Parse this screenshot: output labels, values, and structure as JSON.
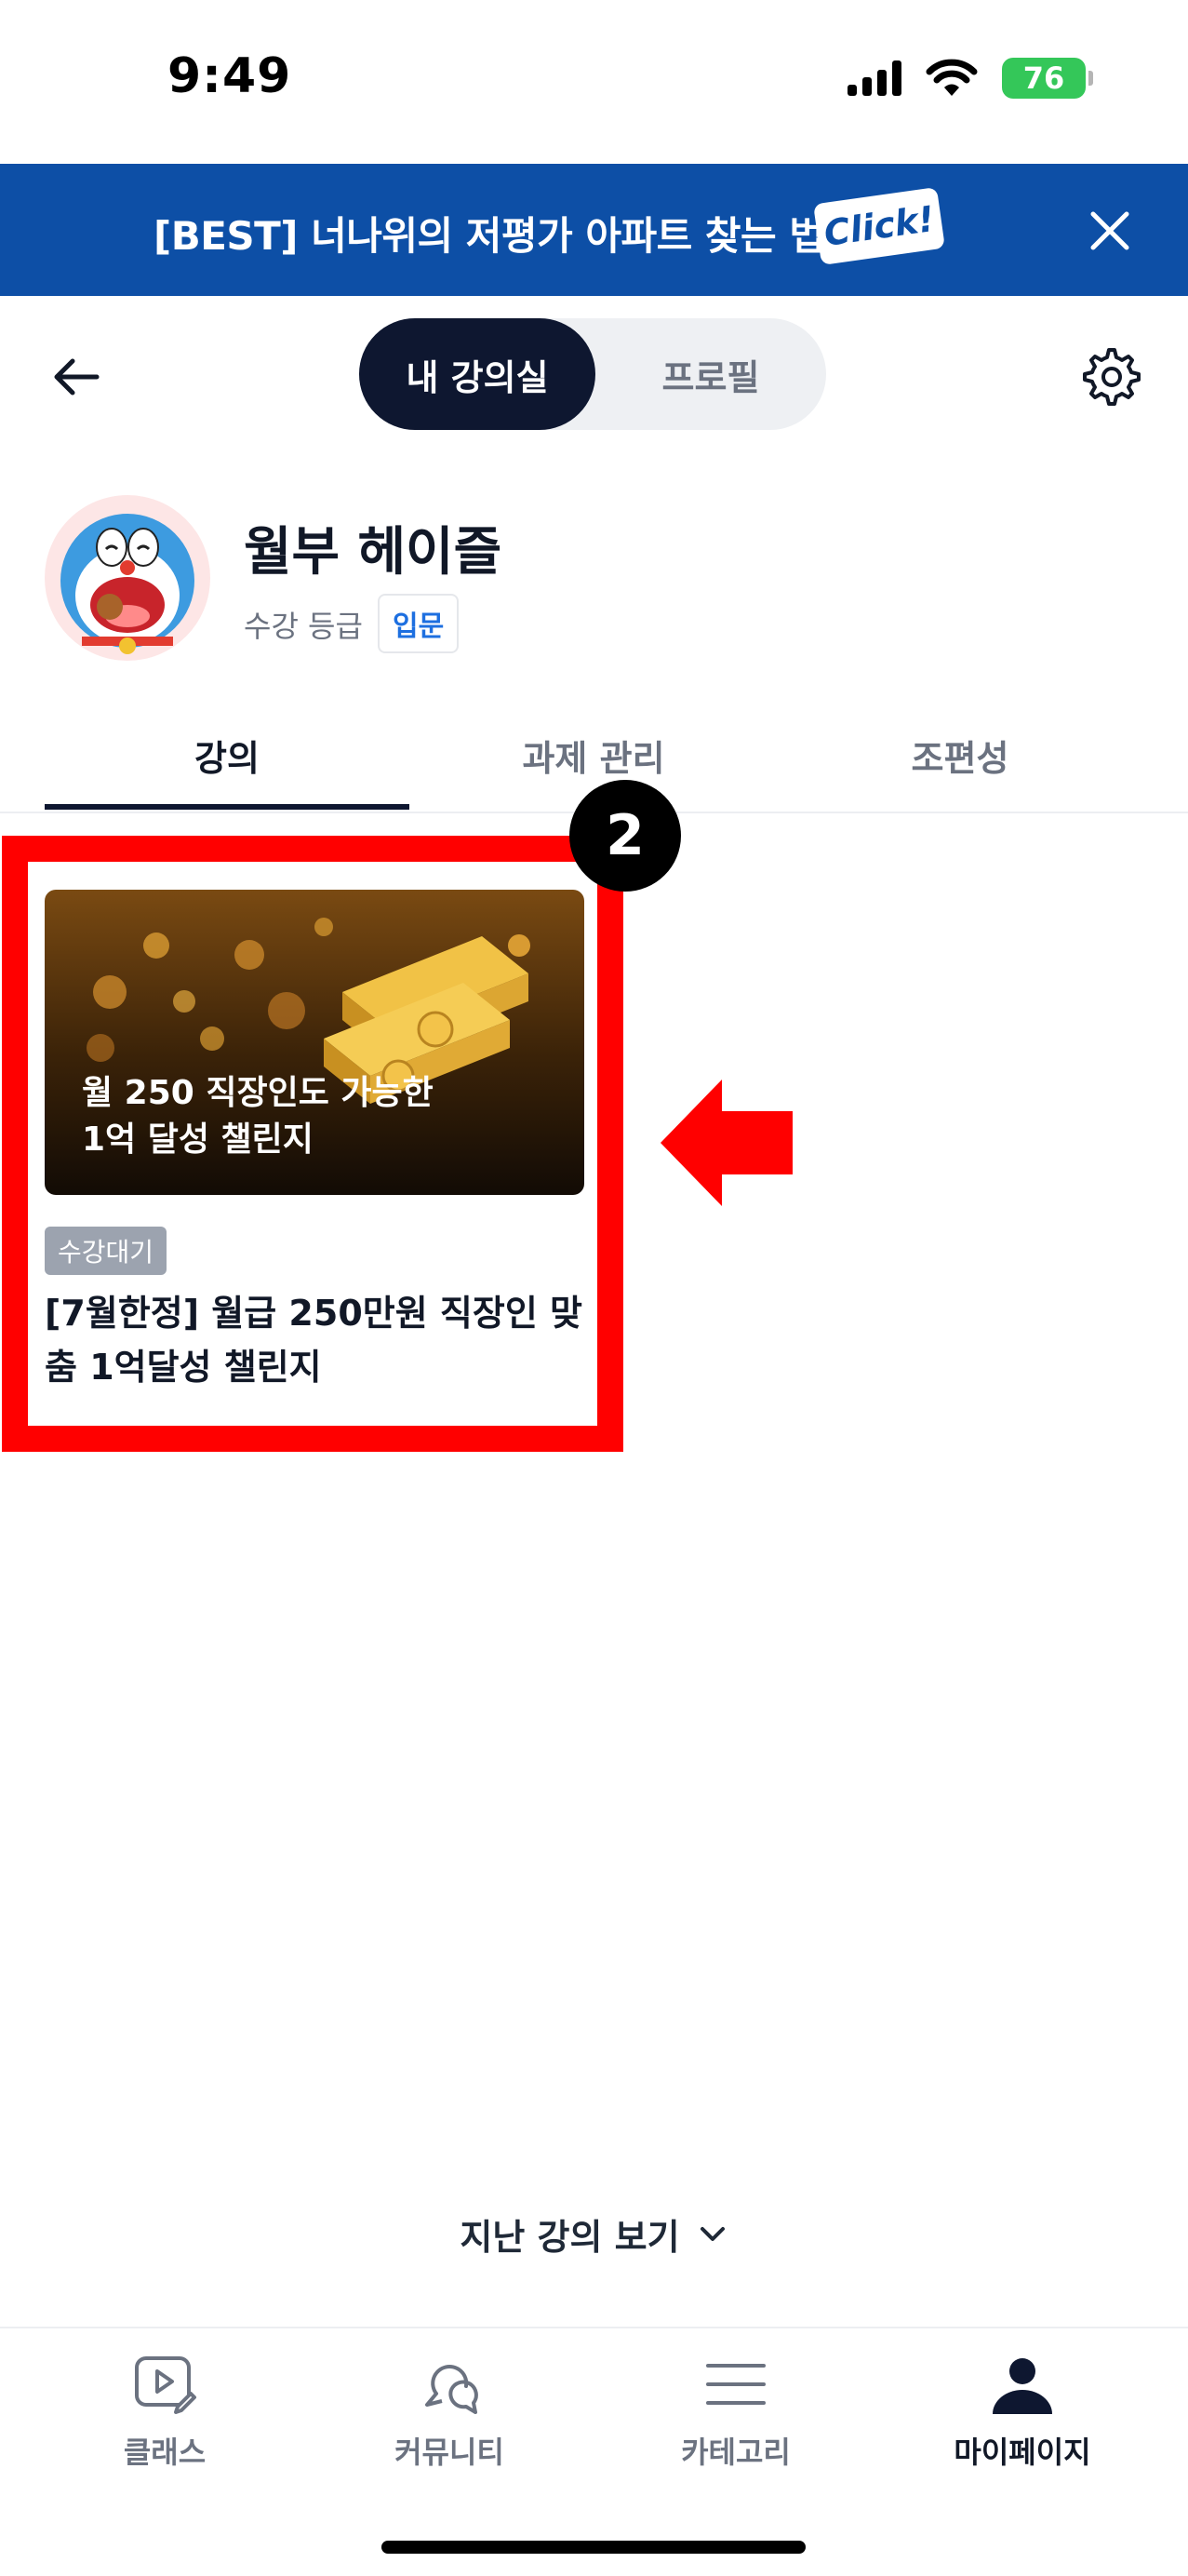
{
  "status_bar": {
    "time": "9:49",
    "battery": "76"
  },
  "promo_banner": {
    "text": "[BEST] 너나위의 저평가 아파트 찾는 법",
    "click_label": "Click!"
  },
  "header": {
    "toggle": {
      "active_label": "내 강의실",
      "inactive_label": "프로필"
    }
  },
  "profile": {
    "name": "월부 헤이즐",
    "grade_label": "수강 등급",
    "grade_value": "입문"
  },
  "tabs": [
    {
      "label": "강의",
      "active": true
    },
    {
      "label": "과제 관리",
      "active": false
    },
    {
      "label": "조편성",
      "active": false
    }
  ],
  "annotation": {
    "step_number": "2",
    "highlight_color": "#ff0000"
  },
  "course": {
    "thumbnail_text_line1": "월 250 직장인도 가능한",
    "thumbnail_text_line2": "1억 달성 챌린지",
    "status_chip": "수강대기",
    "title": "[7월한정] 월급 250만원 직장인 맞춤 1억달성 챌린지"
  },
  "past_lectures": {
    "label": "지난 강의 보기"
  },
  "bottom_nav": [
    {
      "label": "클래스",
      "icon": "class-play-icon",
      "active": false
    },
    {
      "label": "커뮤니티",
      "icon": "community-chat-icon",
      "active": false
    },
    {
      "label": "카테고리",
      "icon": "category-menu-icon",
      "active": false
    },
    {
      "label": "마이페이지",
      "icon": "mypage-person-icon",
      "active": true
    }
  ],
  "colors": {
    "brand_blue": "#0d4fa6",
    "navy": "#0e1730",
    "accent_red": "#ff0000",
    "grade_blue": "#1d6fe0"
  }
}
